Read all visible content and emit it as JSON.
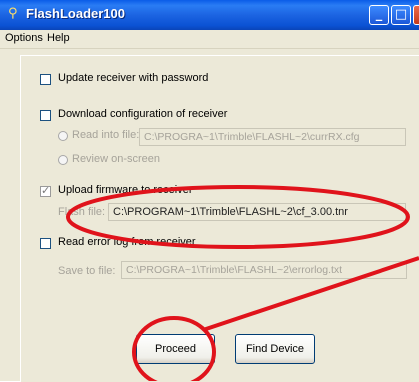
{
  "window": {
    "title": "FlashLoader100"
  },
  "menu": {
    "items": [
      "Options",
      "Help"
    ]
  },
  "options": {
    "update_password": {
      "label": "Update receiver with password",
      "checked": false
    },
    "download_config": {
      "label": "Download configuration of receiver",
      "checked": false,
      "read_into_file": {
        "label": "Read into file:",
        "value": "C:\\PROGRA~1\\Trimble\\FLASHL~2\\currRX.cfg"
      },
      "review_on_screen": {
        "label": "Review on-screen"
      }
    },
    "upload_firmware": {
      "label": "Upload firmware to receiver",
      "checked": true,
      "flash_file": {
        "label": "Flash file:",
        "value": "C:\\PROGRAM~1\\Trimble\\FLASHL~2\\cf_3.00.tnr"
      }
    },
    "read_error_log": {
      "label": "Read error log from receiver",
      "checked": false,
      "save_to_file": {
        "label": "Save to file:",
        "value": "C:\\PROGRA~1\\Trimble\\FLASHL~2\\errorlog.txt"
      }
    }
  },
  "buttons": {
    "proceed": "Proceed",
    "find_device": "Find Device"
  },
  "colors": {
    "annotation": "#e0131b",
    "titlebar": "#0a5ce8"
  }
}
